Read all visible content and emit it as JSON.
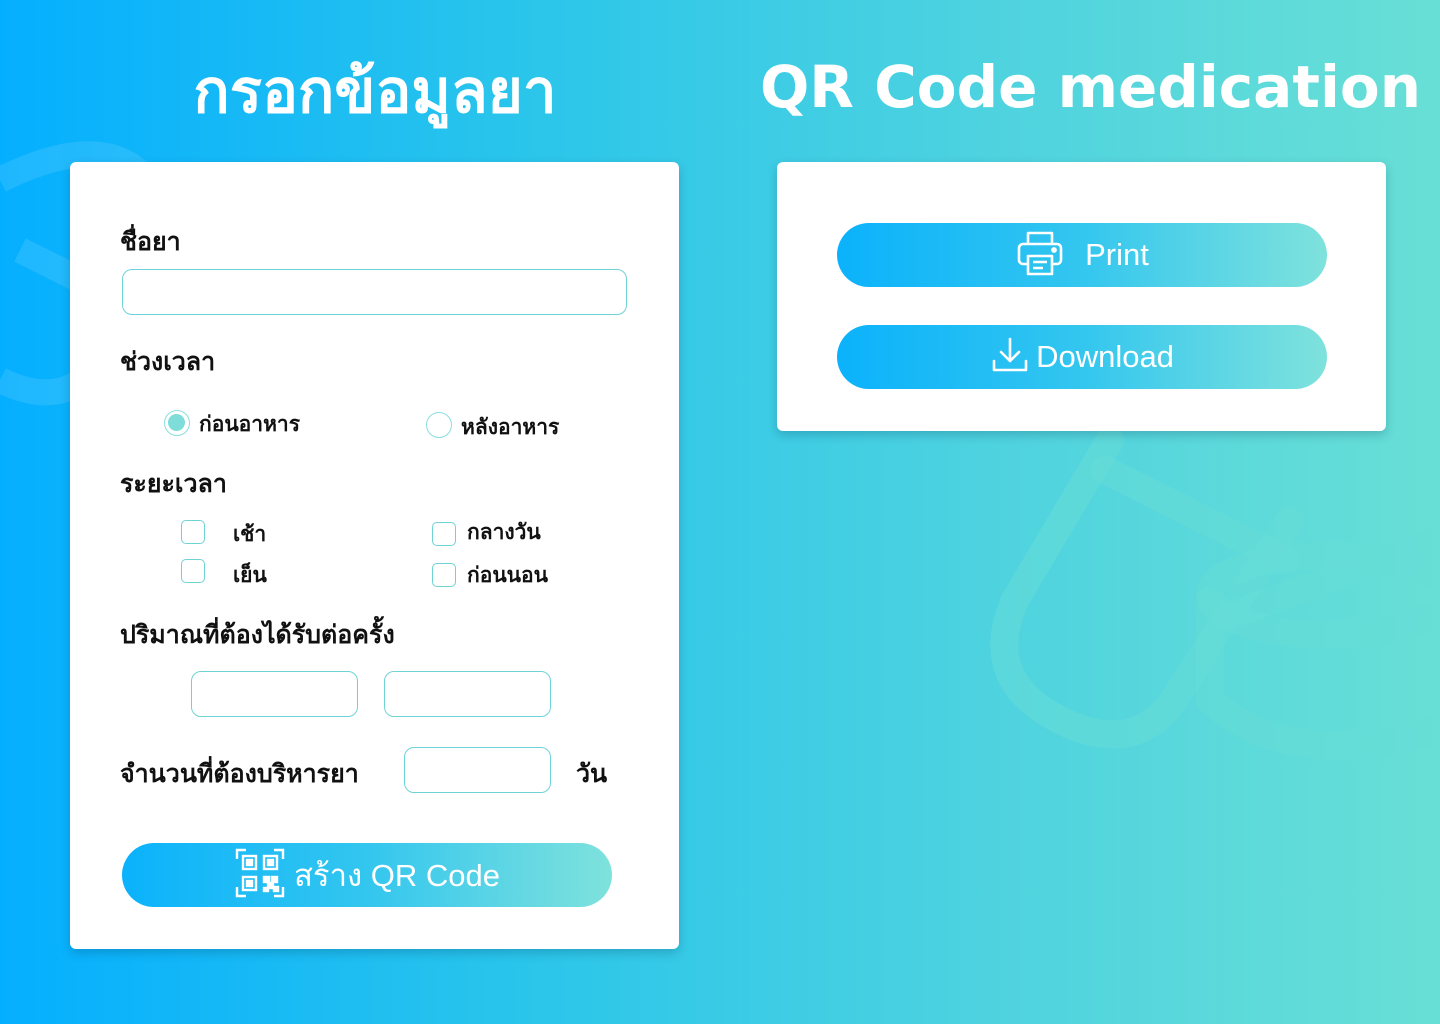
{
  "headings": {
    "form_title": "กรอกข้อมูลยา",
    "qr_title": "QR Code medication"
  },
  "form": {
    "drug_name_label": "ชื่อยา",
    "drug_name_value": "",
    "timing_label": "ช่วงเวลา",
    "timing_options": [
      {
        "label": "ก่อนอาหาร",
        "checked": true
      },
      {
        "label": "หลังอาหาร",
        "checked": false
      }
    ],
    "period_label": "ระยะเวลา",
    "period_options": [
      {
        "label": "เช้า",
        "checked": false
      },
      {
        "label": "กลางวัน",
        "checked": false
      },
      {
        "label": "เย็น",
        "checked": false
      },
      {
        "label": "ก่อนนอน",
        "checked": false
      }
    ],
    "dose_label": "ปริมาณที่ต้องได้รับต่อครั้ง",
    "dose_value_1": "",
    "dose_value_2": "",
    "days_label": "จำนวนที่ต้องบริหารยา",
    "days_value": "",
    "days_unit": "วัน",
    "create_button_label": "สร้าง QR Code"
  },
  "qr_panel": {
    "print_button_label": "Print",
    "download_button_label": "Download"
  },
  "icons": {
    "create": "qr-code-icon",
    "print": "printer-icon",
    "download": "download-icon"
  },
  "colors": {
    "accent_start": "#0bb2fb",
    "accent_end": "#7fe2dc",
    "input_border": "#6fd3d6",
    "radio_fill": "#7edcd9"
  }
}
